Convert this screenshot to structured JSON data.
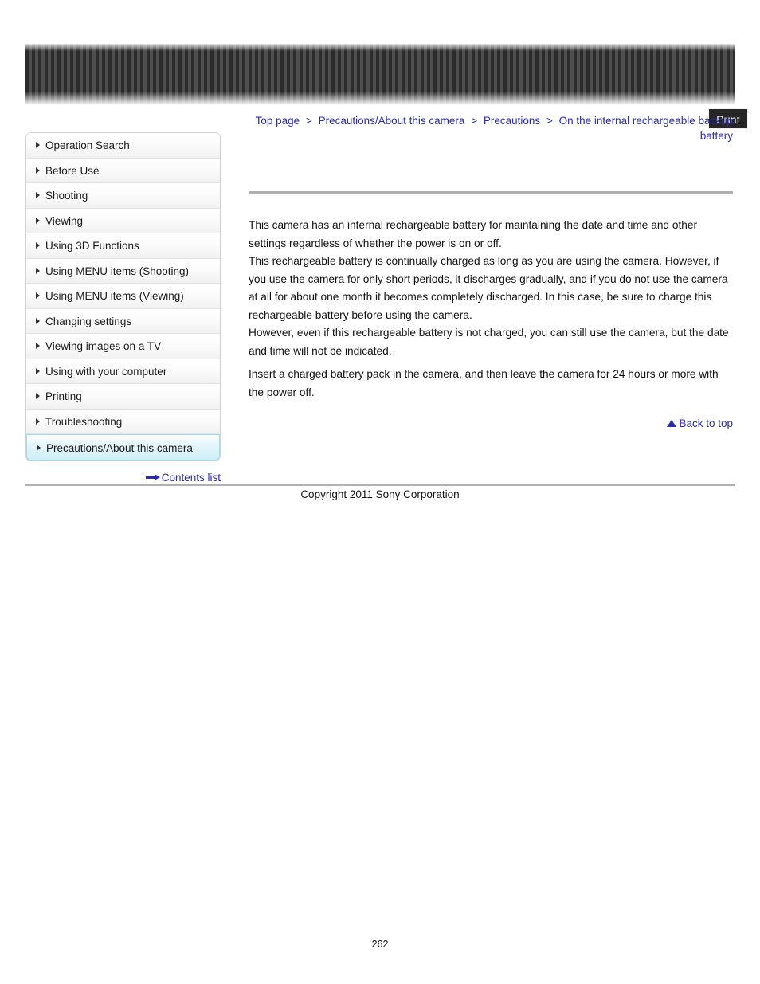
{
  "header": {
    "print_label": "Print"
  },
  "breadcrumb": {
    "separator": ">",
    "items": [
      "Top page",
      "Precautions/About this camera",
      "Precautions",
      "On the internal rechargeable backup battery"
    ]
  },
  "sidebar": {
    "items": [
      {
        "label": "Operation Search",
        "active": false
      },
      {
        "label": "Before Use",
        "active": false
      },
      {
        "label": "Shooting",
        "active": false
      },
      {
        "label": "Viewing",
        "active": false
      },
      {
        "label": "Using 3D Functions",
        "active": false
      },
      {
        "label": "Using MENU items (Shooting)",
        "active": false
      },
      {
        "label": "Using MENU items (Viewing)",
        "active": false
      },
      {
        "label": "Changing settings",
        "active": false
      },
      {
        "label": "Viewing images on a TV",
        "active": false
      },
      {
        "label": "Using with your computer",
        "active": false
      },
      {
        "label": "Printing",
        "active": false
      },
      {
        "label": "Troubleshooting",
        "active": false
      },
      {
        "label": "Precautions/About this camera",
        "active": true
      }
    ],
    "contents_list_label": "Contents list"
  },
  "main": {
    "paragraph_1": "This camera has an internal rechargeable battery for maintaining the date and time and other settings regardless of whether the power is on or off.\nThis rechargeable battery is continually charged as long as you are using the camera. However, if you use the camera for only short periods, it discharges gradually, and if you do not use the camera at all for about one month it becomes completely discharged. In this case, be sure to charge this rechargeable battery before using the camera.\nHowever, even if this rechargeable battery is not charged, you can still use the camera, but the date and time will not be indicated.",
    "paragraph_2": "Insert a charged battery pack in the camera, and then leave the camera for 24 hours or more with the power off.",
    "back_to_top_label": "Back to top"
  },
  "footer": {
    "copyright": "Copyright 2011 Sony Corporation",
    "page_number": "262"
  },
  "colors": {
    "link": "#2a2ab0",
    "rule": "#b0b0b0",
    "active_item": "#cfeef7"
  }
}
